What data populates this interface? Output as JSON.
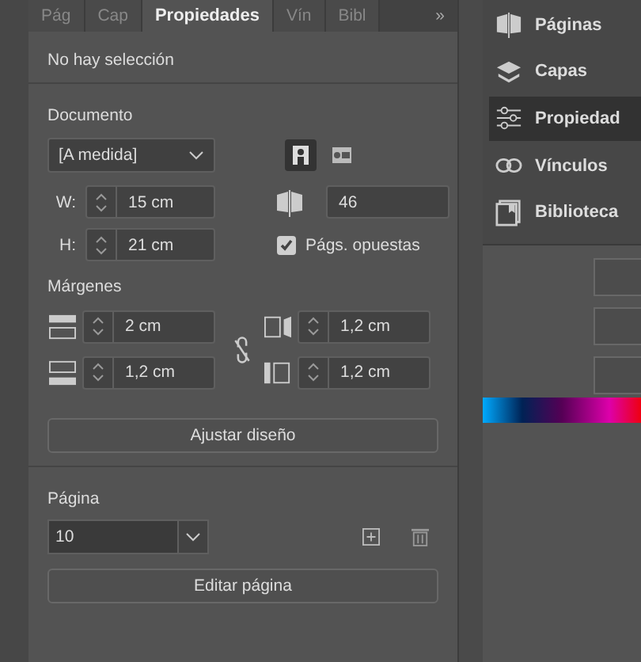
{
  "tabs": [
    {
      "label": "Pág",
      "selected": false
    },
    {
      "label": "Cap",
      "selected": false
    },
    {
      "label": "Propiedades",
      "selected": true
    },
    {
      "label": "Vín",
      "selected": false
    },
    {
      "label": "Bibl",
      "selected": false
    }
  ],
  "tab_overflow": "»",
  "selection_status": "No hay selección",
  "document": {
    "title": "Documento",
    "preset": "[A medida]",
    "orientations": [
      {
        "kind": "portrait",
        "selected": true
      },
      {
        "kind": "landscape",
        "selected": false
      }
    ],
    "width_label": "W:",
    "width": "15 cm",
    "height_label": "H:",
    "height": "21 cm",
    "pages": "46",
    "facing_pages": {
      "label": "Págs. opuestas",
      "checked": true
    }
  },
  "margins": {
    "title": "Márgenes",
    "linked": false,
    "fields": [
      {
        "kind": "top",
        "value": "2 cm"
      },
      {
        "kind": "right",
        "value": "1,2 cm"
      },
      {
        "kind": "bottom",
        "value": "1,2 cm"
      },
      {
        "kind": "left",
        "value": "1,2 cm"
      }
    ]
  },
  "adjust_button": "Ajustar diseño",
  "page": {
    "title": "Página",
    "value": "10"
  },
  "edit_button": "Editar página",
  "side_panels": [
    {
      "kind": "pages",
      "label": "Páginas",
      "selected": false
    },
    {
      "kind": "layers",
      "label": "Capas",
      "selected": false
    },
    {
      "kind": "properties",
      "label": "Propiedad",
      "selected": true
    },
    {
      "kind": "links",
      "label": "Vínculos",
      "selected": false
    },
    {
      "kind": "library",
      "label": "Biblioteca",
      "selected": false
    }
  ]
}
